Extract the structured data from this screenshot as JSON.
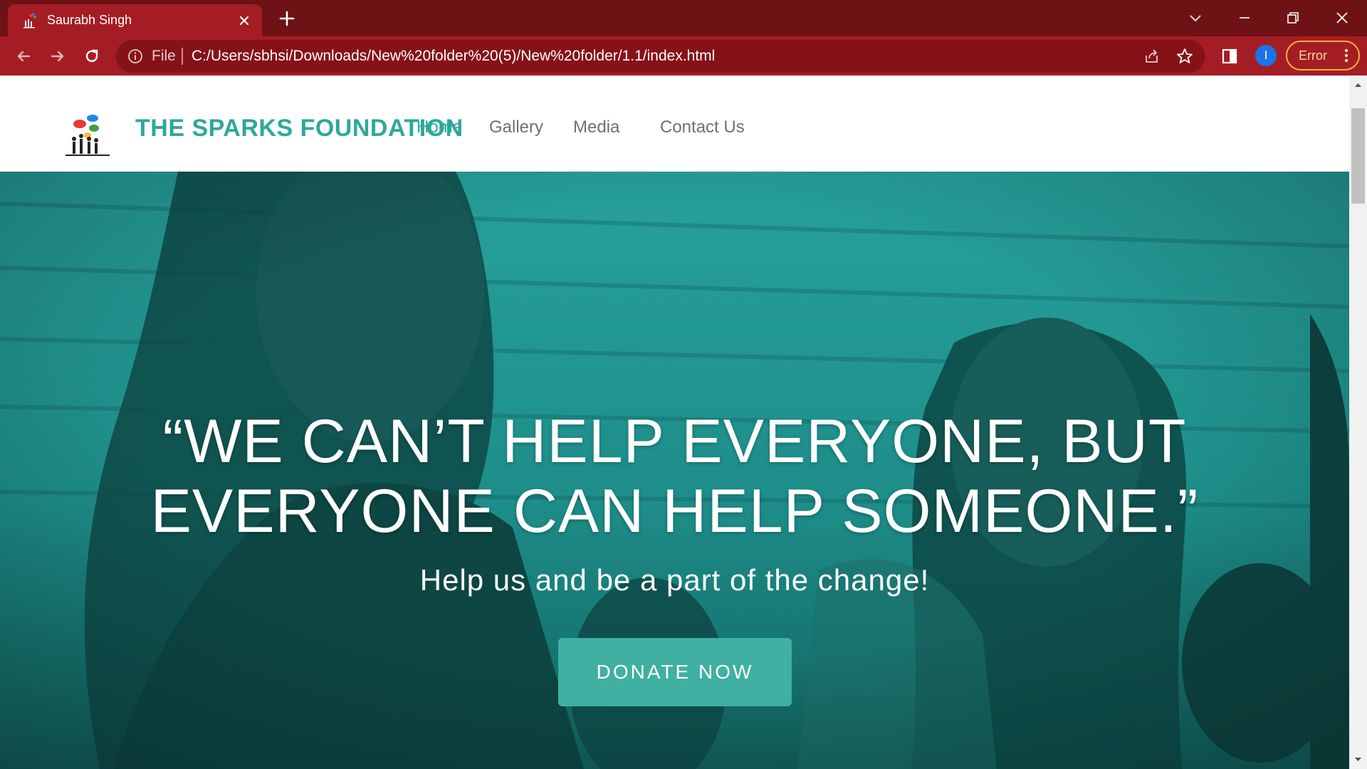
{
  "browser": {
    "tab": {
      "title": "Saurabh Singh",
      "favicon": "sparks-logo-icon"
    },
    "address_bar": {
      "scheme_label": "File",
      "url": "C:/Users/sbhsi/Downloads/New%20folder%20(5)/New%20folder/1.1/index.html"
    },
    "profile_initial": "I",
    "error_label": "Error",
    "colors": {
      "tabstrip": "#6e1216",
      "toolbar": "#a51d24",
      "omnibox": "#861218",
      "error_chip_border": "#f2b33d",
      "avatar": "#1a73e8"
    }
  },
  "site": {
    "title": "THE SPARKS FOUNDATION",
    "nav": [
      {
        "label": "Home",
        "active": true
      },
      {
        "label": "Gallery",
        "active": false
      },
      {
        "label": "Media",
        "active": false
      },
      {
        "label": "Contact Us",
        "active": false
      }
    ],
    "hero": {
      "quote_line1": "“WE CAN’T HELP EVERYONE, BUT",
      "quote_line2": "EVERYONE CAN HELP SOMEONE.”",
      "subtitle": "Help us and be a part of the change!",
      "cta_label": "DONATE NOW"
    },
    "colors": {
      "brand_teal": "#2ea89a",
      "hero_overlay": "#1b8a86",
      "cta_button": "#3fb0a2",
      "nav_inactive": "#707070"
    }
  }
}
